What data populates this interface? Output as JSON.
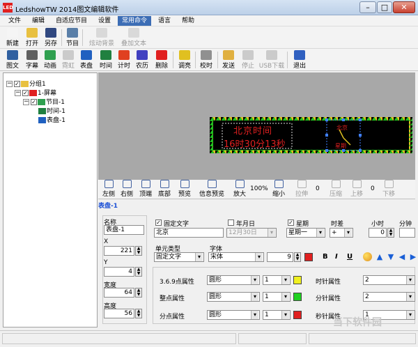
{
  "window": {
    "title": "LedshowTW 2014图文编辑软件",
    "app_icon_text": "LED"
  },
  "menu": [
    {
      "label": "文件"
    },
    {
      "label": "编辑"
    },
    {
      "label": "自适应节目"
    },
    {
      "label": "设置"
    },
    {
      "label": "常用命令",
      "active": true
    },
    {
      "label": "语言"
    },
    {
      "label": "帮助"
    }
  ],
  "toolbar1": [
    {
      "label": "新建",
      "icon": "new-file-icon",
      "color": "#f5f5f5"
    },
    {
      "label": "打开",
      "icon": "open-folder-icon",
      "color": "#e8c040"
    },
    {
      "label": "另存",
      "icon": "save-icon",
      "color": "#304880"
    },
    {
      "label": "节目",
      "icon": "program-icon",
      "color": "#5a7fa8"
    },
    {
      "label": "炫动背景",
      "icon": "animated-background-icon",
      "color": "#c8c8c8",
      "disabled": true
    },
    {
      "label": "叠加文本",
      "icon": "overlay-text-icon",
      "color": "#c8c8c8",
      "disabled": true
    }
  ],
  "toolbar2": [
    {
      "label": "图文",
      "icon": "graphic-text-icon",
      "color": "#3060a0"
    },
    {
      "label": "字幕",
      "icon": "subtitle-icon",
      "color": "#606060"
    },
    {
      "label": "动画",
      "icon": "animation-icon",
      "color": "#30a050"
    },
    {
      "label": "霓虹",
      "icon": "neon-icon",
      "color": "#b0b0b0",
      "disabled": true
    },
    {
      "label": "表盘",
      "icon": "clock-dial-icon",
      "color": "#2060c0"
    },
    {
      "label": "时间",
      "icon": "time-icon",
      "color": "#208040"
    },
    {
      "label": "计时",
      "icon": "timer-icon",
      "color": "#e04020"
    },
    {
      "label": "农历",
      "icon": "lunar-calendar-icon",
      "color": "#4040c0"
    },
    {
      "label": "删除",
      "icon": "delete-icon",
      "color": "#e02020"
    },
    {
      "label": "调亮",
      "icon": "brightness-icon",
      "color": "#e0c020"
    },
    {
      "label": "校时",
      "icon": "clock-sync-icon",
      "color": "#909090"
    },
    {
      "label": "发送",
      "icon": "send-icon",
      "color": "#e0b040"
    },
    {
      "label": "停止",
      "icon": "stop-icon",
      "color": "#b0b0b0",
      "disabled": true
    },
    {
      "label": "USB下载",
      "icon": "usb-download-icon",
      "color": "#b0b0b0",
      "disabled": true
    },
    {
      "label": "退出",
      "icon": "exit-icon",
      "color": "#3060c0"
    }
  ],
  "tree": [
    {
      "label": "分组1",
      "level": 0,
      "expander": "⊟",
      "icon": "folder-icon",
      "icon_color": "#e8c040"
    },
    {
      "label": "1-屏幕",
      "level": 1,
      "expander": "⊟",
      "icon": "screen-icon",
      "icon_color": "#e02020"
    },
    {
      "label": "节目-1",
      "level": 2,
      "expander": "⊟",
      "icon": "program-icon",
      "icon_color": "#30a050"
    },
    {
      "label": "时间-1",
      "level": 3,
      "expander": "",
      "icon": "time-icon",
      "icon_color": "#208040"
    },
    {
      "label": "表盘-1",
      "level": 3,
      "expander": "",
      "icon": "clock-dial-icon",
      "icon_color": "#2060c0"
    }
  ],
  "led": {
    "line1": "北京时间",
    "line2": "16时30分13秒",
    "dial_text1": "北京",
    "dial_text2": "星期",
    "text_color": "#e02020"
  },
  "preview_toolbar": [
    {
      "label": "左侧",
      "icon": "align-left-icon"
    },
    {
      "label": "右侧",
      "icon": "align-right-icon"
    },
    {
      "label": "顶端",
      "icon": "align-top-icon"
    },
    {
      "label": "底部",
      "icon": "align-bottom-icon"
    },
    {
      "label": "预览",
      "icon": "preview-icon"
    },
    {
      "label": "信息预览",
      "icon": "info-preview-icon"
    },
    {
      "label": "放大",
      "icon": "zoom-in-icon"
    },
    {
      "label": "缩小",
      "icon": "zoom-out-icon"
    },
    {
      "label": "拉伸",
      "icon": "stretch-icon",
      "disabled": true
    },
    {
      "label": "压缩",
      "icon": "compress-icon",
      "disabled": true
    },
    {
      "label": "上移",
      "icon": "move-up-icon",
      "disabled": true
    },
    {
      "label": "下移",
      "icon": "move-down-icon",
      "disabled": true
    }
  ],
  "zoom_value": "100%",
  "stretch_value": "0",
  "compress_value": "0",
  "selected_item_title": "表盘-1",
  "props": {
    "name_label": "名称",
    "name_value": "表盘-1",
    "x_label": "X",
    "x_value": "221",
    "y_label": "Y",
    "y_value": "4",
    "width_label": "宽度",
    "width_value": "64",
    "height_label": "高度",
    "height_value": "56",
    "fixed_text_label": "固定文字",
    "fixed_text_checked": true,
    "fixed_text_value": "北京",
    "date_label": "年月日",
    "date_checked": false,
    "date_value": "12月30日",
    "week_label": "星期",
    "week_checked": true,
    "week_value": "星期一",
    "tz_label": "时差",
    "tz_value": "+",
    "hour_label": "小时",
    "hour_value": "0",
    "minute_label": "分钟",
    "unit_type_label": "单元类型",
    "unit_type_value": "固定文字",
    "font_label": "字体",
    "font_value": "宋体",
    "font_size_value": "9",
    "font_color": "#e02020",
    "bold_label": "B",
    "italic_label": "I",
    "underline_label": "U",
    "p369_label": "3.6.9点属性",
    "p369_shape": "圆形",
    "p369_size": "1",
    "p369_color": "#f0f020",
    "hour_point_label": "整点属性",
    "hour_point_shape": "圆形",
    "hour_point_size": "1",
    "hour_point_color": "#20d020",
    "min_point_label": "分点属性",
    "min_point_shape": "圆形",
    "min_point_size": "1",
    "min_point_color": "#e02020",
    "hour_hand_label": "时针属性",
    "hour_hand_value": "2",
    "minute_hand_label": "分针属性",
    "minute_hand_value": "2",
    "second_hand_label": "秒针属性",
    "second_hand_value": "1"
  },
  "watermark": {
    "text": "当下软件园"
  }
}
